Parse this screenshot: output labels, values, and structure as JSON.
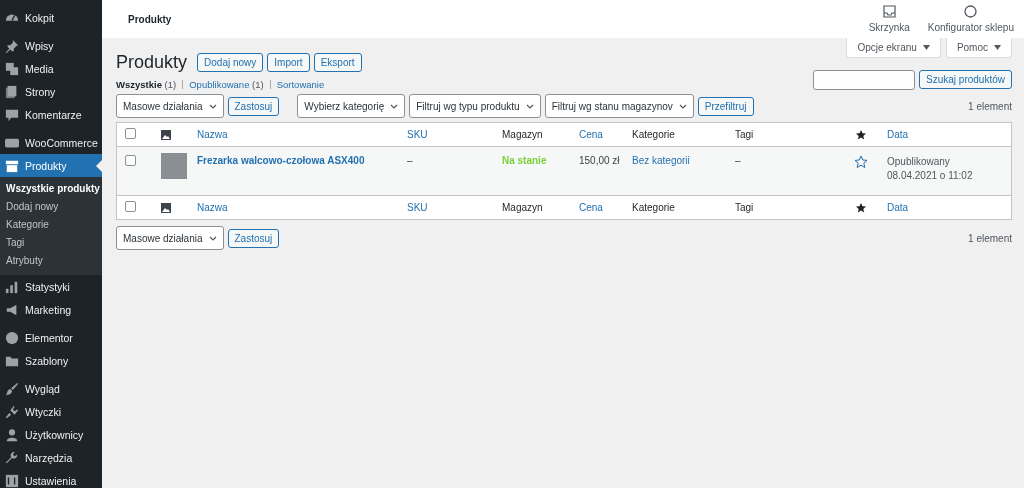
{
  "sidebar": {
    "groups": [
      [
        {
          "label": "Kokpit",
          "selected": false
        }
      ],
      [
        {
          "label": "Wpisy",
          "selected": false
        },
        {
          "label": "Media",
          "selected": false
        },
        {
          "label": "Strony",
          "selected": false
        },
        {
          "label": "Komentarze",
          "selected": false
        }
      ],
      [
        {
          "label": "WooCommerce",
          "selected": false
        },
        {
          "label": "Produkty",
          "selected": true,
          "children": [
            {
              "label": "Wszystkie produkty",
              "selected": true
            },
            {
              "label": "Dodaj nowy",
              "selected": false
            },
            {
              "label": "Kategorie",
              "selected": false
            },
            {
              "label": "Tagi",
              "selected": false
            },
            {
              "label": "Atrybuty",
              "selected": false
            }
          ]
        },
        {
          "label": "Statystyki",
          "selected": false
        },
        {
          "label": "Marketing",
          "selected": false
        }
      ],
      [
        {
          "label": "Elementor",
          "selected": false
        },
        {
          "label": "Szablony",
          "selected": false
        }
      ],
      [
        {
          "label": "Wygląd",
          "selected": false
        },
        {
          "label": "Wtyczki",
          "selected": false
        },
        {
          "label": "Użytkownicy",
          "selected": false
        },
        {
          "label": "Narzędzia",
          "selected": false
        },
        {
          "label": "Ustawienia",
          "selected": false
        }
      ]
    ]
  },
  "header": {
    "title": "Produkty",
    "actions": [
      {
        "label": "Skrzynka"
      },
      {
        "label": "Konfigurator sklepu"
      }
    ]
  },
  "screen_tabs": [
    "Opcje ekranu",
    "Pomoc"
  ],
  "page": {
    "title": "Produkty",
    "buttons": [
      "Dodaj nowy",
      "Import",
      "Eksport"
    ],
    "views": [
      {
        "label": "Wszystkie",
        "count": "(1)",
        "selected": true
      },
      {
        "label": "Opublikowane",
        "count": "(1)",
        "selected": false
      },
      {
        "label": "Sortowanie",
        "selected": false
      }
    ],
    "search": {
      "button": "Szukaj produktów"
    }
  },
  "tablenav_top": {
    "bulk": "Masowe działania",
    "apply": "Zastosuj",
    "filters": [
      "Wybierz kategorię",
      "Filtruj wg typu produktu",
      "Filtruj wg stanu magazynov"
    ],
    "filter_button": "Przefiltruj",
    "count": "1 element"
  },
  "table": {
    "header_columns": [
      {
        "kind": "checkbox",
        "checked": false
      },
      {
        "kind": "image"
      },
      {
        "kind": "text",
        "label": "Nazwa",
        "sortable": true
      },
      {
        "kind": "text",
        "label": "SKU",
        "sortable": true
      },
      {
        "kind": "text",
        "label": "Magazyn",
        "sortable": false
      },
      {
        "kind": "text",
        "label": "Cena",
        "sortable": true
      },
      {
        "kind": "text",
        "label": "Kategorie",
        "sortable": false
      },
      {
        "kind": "text",
        "label": "Tagi",
        "sortable": false
      },
      {
        "kind": "featured"
      },
      {
        "kind": "text",
        "label": "Data",
        "sortable": true
      }
    ],
    "footer_columns": [
      {
        "kind": "checkbox",
        "checked": false
      },
      {
        "kind": "image"
      },
      {
        "kind": "text",
        "label": "Nazwa",
        "sortable": true
      },
      {
        "kind": "text",
        "label": "SKU",
        "sortable": true
      },
      {
        "kind": "text",
        "label": "Magazyn",
        "sortable": false
      },
      {
        "kind": "text",
        "label": "Cena",
        "sortable": true
      },
      {
        "kind": "text",
        "label": "Kategorie",
        "sortable": false
      },
      {
        "kind": "text",
        "label": "Tagi",
        "sortable": false
      },
      {
        "kind": "featured"
      },
      {
        "kind": "text",
        "label": "Data",
        "sortable": true
      }
    ],
    "rows": [
      {
        "checked": false,
        "name": "Frezarka walcowo-czołowa ASX400",
        "sku": "–",
        "stock": "Na stanie",
        "in_stock": true,
        "price": "150,00 zł",
        "categories": "Bez kategorii",
        "tags": "–",
        "featured": false,
        "date_status": "Opublikowany",
        "date": "08.04.2021 o 11:02"
      }
    ]
  },
  "tablenav_bottom": {
    "bulk": "Masowe działania",
    "apply": "Zastosuj",
    "count": "1 element"
  }
}
